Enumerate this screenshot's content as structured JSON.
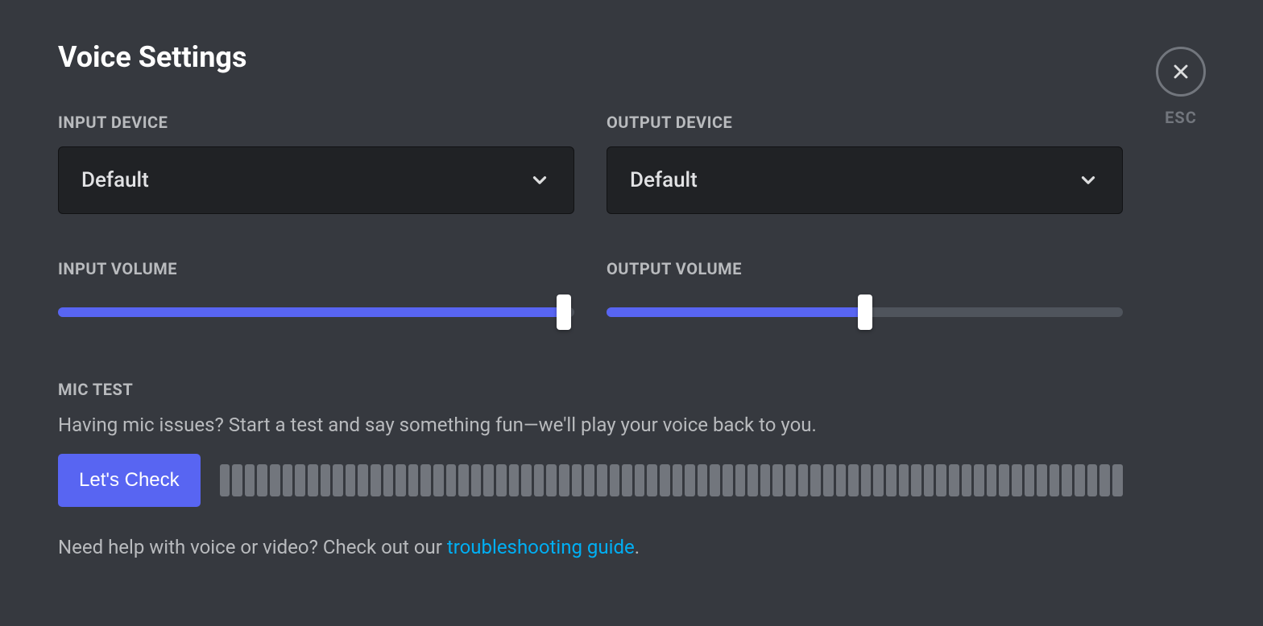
{
  "title": "Voice Settings",
  "close": {
    "esc_label": "ESC"
  },
  "input_device": {
    "label": "INPUT DEVICE",
    "selected": "Default"
  },
  "output_device": {
    "label": "OUTPUT DEVICE",
    "selected": "Default"
  },
  "input_volume": {
    "label": "INPUT VOLUME",
    "percent": 98
  },
  "output_volume": {
    "label": "OUTPUT VOLUME",
    "percent": 50
  },
  "mic_test": {
    "label": "MIC TEST",
    "description": "Having mic issues? Start a test and say something fun—we'll play your voice back to you.",
    "button": "Let's Check",
    "meter_bars": 72
  },
  "help": {
    "prefix": "Need help with voice or video? Check out our ",
    "link_text": "troubleshooting guide",
    "suffix": "."
  },
  "colors": {
    "accent": "#5865f2",
    "link": "#00aff4"
  }
}
